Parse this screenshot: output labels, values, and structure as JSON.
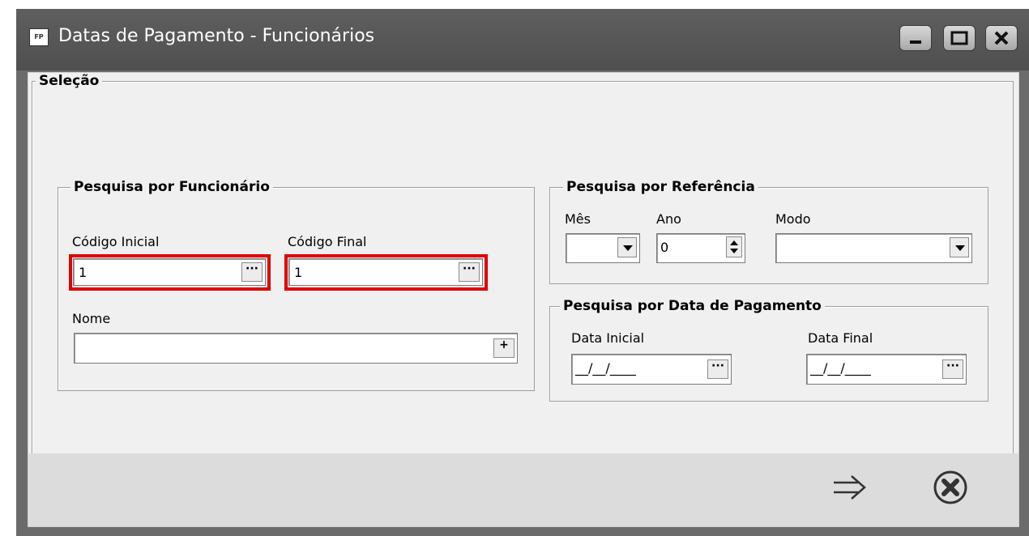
{
  "window": {
    "app_icon_text": "FP",
    "title": "Datas de Pagamento - Funcionários"
  },
  "selection_group": {
    "title": "Seleção"
  },
  "funcionario_group": {
    "title": "Pesquisa por Funcionário",
    "codigo_inicial_label": "Código Inicial",
    "codigo_inicial_value": "1",
    "codigo_final_label": "Código Final",
    "codigo_final_value": "1",
    "nome_label": "Nome",
    "nome_value": "",
    "ellipsis": "···",
    "plus": "+"
  },
  "referencia_group": {
    "title": "Pesquisa por Referência",
    "mes_label": "Mês",
    "mes_value": "",
    "ano_label": "Ano",
    "ano_value": "0",
    "modo_label": "Modo",
    "modo_value": ""
  },
  "data_pagamento_group": {
    "title": "Pesquisa por Data de Pagamento",
    "data_inicial_label": "Data Inicial",
    "data_inicial_value": "__/__/____",
    "data_final_label": "Data Final",
    "data_final_value": "__/__/____"
  },
  "highlight_color": "#e00000"
}
